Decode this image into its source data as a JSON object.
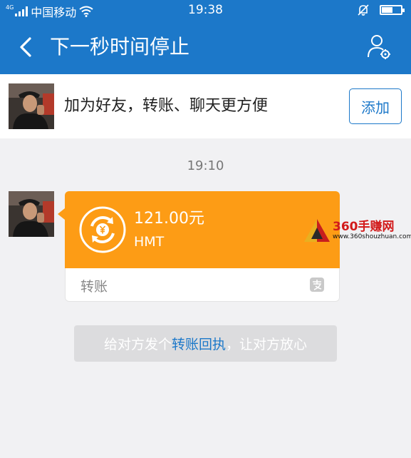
{
  "status_bar": {
    "network": "4G",
    "carrier": "中国移动",
    "time": "19:38",
    "icons": [
      "signal-icon",
      "wifi-icon",
      "mute-icon",
      "battery-icon"
    ]
  },
  "nav": {
    "back_icon": "chevron-left-icon",
    "title": "下一秒时间停止",
    "profile_icon": "profile-settings-icon"
  },
  "friend_bar": {
    "prompt": "加为好友，转账、聊天更方便",
    "add_label": "添加"
  },
  "chat": {
    "timestamp": "19:10",
    "transfer": {
      "amount": "121.00元",
      "note": "HMT",
      "kind": "转账",
      "icon": "yuan-exchange-icon",
      "badge_icon": "alipay-icon",
      "accent": "#fd9c15"
    },
    "receipt_prefix": "给对方发个",
    "receipt_link": "转账回执",
    "receipt_suffix": "，让对方放心"
  },
  "watermark": {
    "brand": "360手赚网",
    "url": "www.360shouzhuan.com"
  },
  "colors": {
    "primary": "#1c78c9",
    "accent": "#fd9c15",
    "background": "#f1f1f3"
  }
}
